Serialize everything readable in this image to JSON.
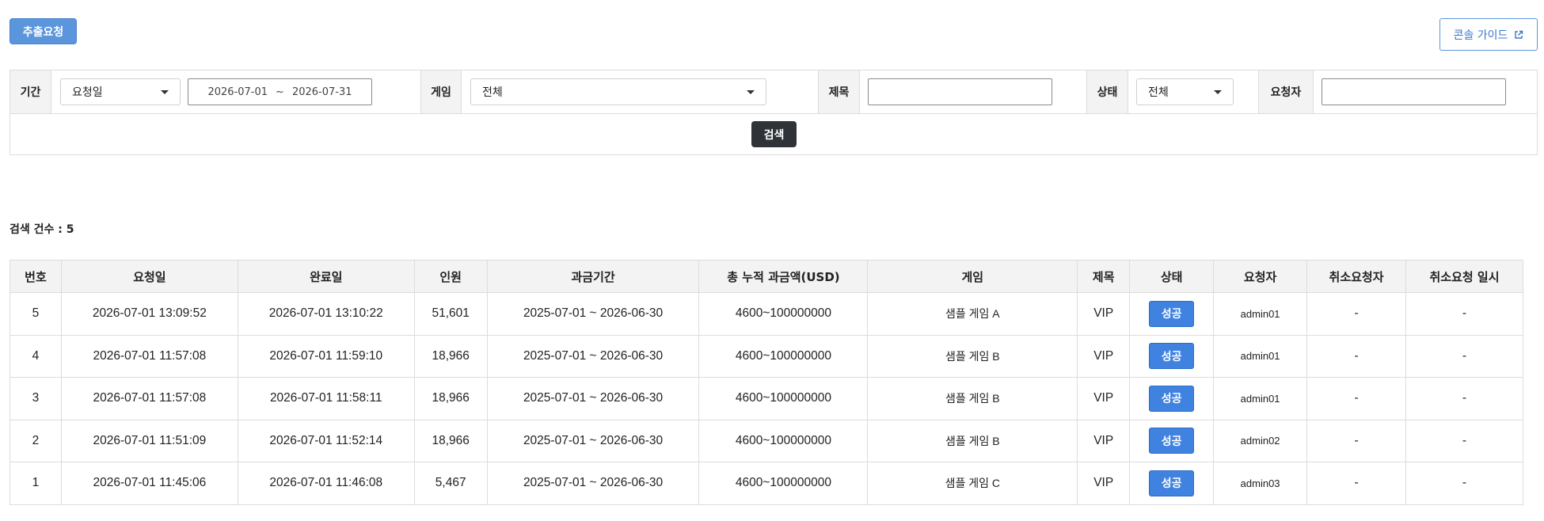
{
  "toolbar": {
    "extract_label": "추출요청",
    "guide_label": "콘솔 가이드"
  },
  "filter": {
    "period_label": "기간",
    "period_type": "요청일",
    "date_from": "2026-07-01",
    "date_sep": "~",
    "date_to": "2026-07-31",
    "game_label": "게임",
    "game_value": "전체",
    "title_label": "제목",
    "title_value": "",
    "status_label": "상태",
    "status_value": "전체",
    "requester_label": "요청자",
    "requester_value": "",
    "search_label": "검색"
  },
  "results": {
    "count_text": "검색 건수 : 5",
    "columns": [
      "번호",
      "요청일",
      "완료일",
      "인원",
      "과금기간",
      "총 누적 과금액(USD)",
      "게임",
      "제목",
      "상태",
      "요청자",
      "취소요청자",
      "취소요청 일시"
    ],
    "rows": [
      {
        "no": "5",
        "requested": "2026-07-01 13:09:52",
        "completed": "2026-07-01 13:10:22",
        "count": "51,601",
        "period": "2025-07-01 ~ 2026-06-30",
        "amount": "4600~100000000",
        "game": "샘플 게임 A",
        "title": "VIP",
        "status": "성공",
        "requester": "admin01",
        "cancel_by": "-",
        "cancel_at": "-"
      },
      {
        "no": "4",
        "requested": "2026-07-01 11:57:08",
        "completed": "2026-07-01 11:59:10",
        "count": "18,966",
        "period": "2025-07-01 ~ 2026-06-30",
        "amount": "4600~100000000",
        "game": "샘플 게임 B",
        "title": "VIP",
        "status": "성공",
        "requester": "admin01",
        "cancel_by": "-",
        "cancel_at": "-"
      },
      {
        "no": "3",
        "requested": "2026-07-01 11:57:08",
        "completed": "2026-07-01 11:58:11",
        "count": "18,966",
        "period": "2025-07-01 ~ 2026-06-30",
        "amount": "4600~100000000",
        "game": "샘플 게임 B",
        "title": "VIP",
        "status": "성공",
        "requester": "admin01",
        "cancel_by": "-",
        "cancel_at": "-"
      },
      {
        "no": "2",
        "requested": "2026-07-01 11:51:09",
        "completed": "2026-07-01 11:52:14",
        "count": "18,966",
        "period": "2025-07-01 ~ 2026-06-30",
        "amount": "4600~100000000",
        "game": "샘플 게임 B",
        "title": "VIP",
        "status": "성공",
        "requester": "admin02",
        "cancel_by": "-",
        "cancel_at": "-"
      },
      {
        "no": "1",
        "requested": "2026-07-01 11:45:06",
        "completed": "2026-07-01 11:46:08",
        "count": "5,467",
        "period": "2025-07-01 ~ 2026-06-30",
        "amount": "4600~100000000",
        "game": "샘플 게임 C",
        "title": "VIP",
        "status": "성공",
        "requester": "admin03",
        "cancel_by": "-",
        "cancel_at": "-"
      }
    ]
  },
  "colors": {
    "primary": "#5b95dc",
    "status_success": "#3f82e0",
    "search_button": "#2f3338"
  }
}
